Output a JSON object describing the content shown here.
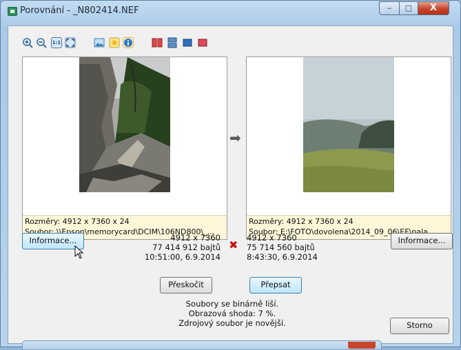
{
  "window": {
    "title": "Porovnání - _N802414.NEF"
  },
  "title_buttons": {
    "minimize": "‒",
    "maximize": "□",
    "close": "X"
  },
  "toolbar": {
    "icons": [
      "zoom-in-icon",
      "zoom-out-icon",
      "actual-size-icon",
      "fit-to-window-icon",
      "image-view-icon",
      "highlight-icon",
      "info-icon",
      "side-by-side-icon",
      "stacked-icon",
      "view-blue-icon",
      "view-red-icon"
    ],
    "actual_size_label": "1:1"
  },
  "left": {
    "dimensions": "Rozměry: 4912 x 7360 x 24",
    "file": "Soubor: \\\\Epson\\memorycard\\DCIM\\106ND800\\_..."
  },
  "right": {
    "dimensions": "Rozměry: 4912 x 7360 x 24",
    "file": "Soubor: E:\\FOTO\\dovolena\\2014_09_06\\EF\\pala..."
  },
  "arrow": "➡",
  "compare": {
    "left_size": "4912 x 7360",
    "left_bytes": "77 414 912 bajtů",
    "left_date": "10:51:00, 6.9.2014",
    "mismatch_symbol": "✖",
    "right_size": "4912 x 7360",
    "right_bytes": "75 714 560 bajtů",
    "right_date": "8:43:30, 6.9.2014"
  },
  "buttons": {
    "info_left": "Informace...",
    "info_right": "Informace...",
    "skip": "Přeskočit",
    "overwrite": "Přepsat",
    "cancel": "Storno"
  },
  "status": {
    "line1": "Soubory se binárně liší.",
    "line2": "Obrazová shoda: 7 %.",
    "line3": "Zdrojový soubor je novější."
  },
  "colors": {
    "accent": "#3c7fb1",
    "mismatch": "#d01010",
    "info_bg": "#fdf6d8"
  }
}
